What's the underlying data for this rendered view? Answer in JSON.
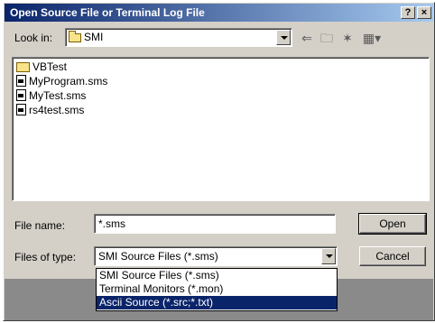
{
  "window": {
    "title": "Open Source File or Terminal Log File",
    "help_glyph": "?",
    "close_glyph": "×"
  },
  "lookin": {
    "label": "Look in:",
    "value": "SMI"
  },
  "toolbar": {
    "back_icon": "back-arrow-icon",
    "up_icon": "up-folder-icon",
    "new_folder_icon": "new-folder-icon",
    "view_icon": "view-menu-icon"
  },
  "files": [
    {
      "name": "VBTest",
      "type": "folder"
    },
    {
      "name": "MyProgram.sms",
      "type": "file"
    },
    {
      "name": "MyTest.sms",
      "type": "file"
    },
    {
      "name": "rs4test.sms",
      "type": "file"
    }
  ],
  "filename": {
    "label": "File name:",
    "value": "*.sms"
  },
  "filetype": {
    "label": "Files of type:",
    "value": "SMI Source Files (*.sms)",
    "options": [
      "SMI Source Files (*.sms)",
      "Terminal Monitors (*.mon)",
      "Ascii Source (*.src;*.txt)"
    ],
    "selected_index": 2
  },
  "buttons": {
    "open": "Open",
    "cancel": "Cancel"
  },
  "colors": {
    "title_start": "#0a246a",
    "title_end": "#a6caf0",
    "face": "#d4d0c8",
    "selection": "#0a246a"
  }
}
